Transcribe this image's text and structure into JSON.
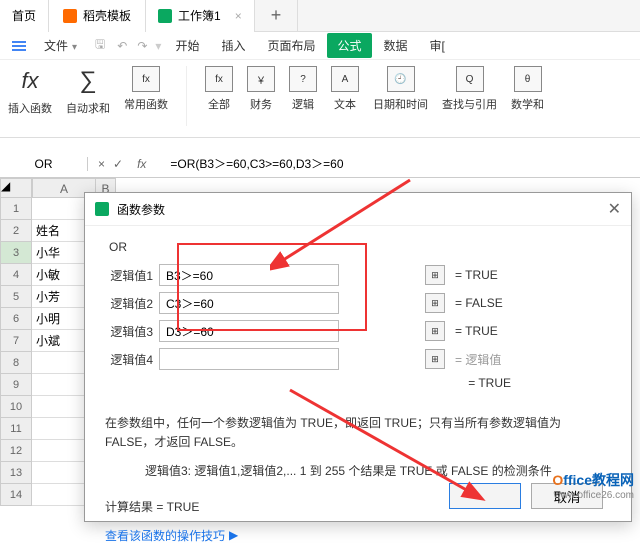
{
  "tabs": {
    "home": "首页",
    "docker": "稻壳模板",
    "sheet": "工作簿1",
    "plus": "+"
  },
  "menu": {
    "file": "文件",
    "start": "开始",
    "insert": "插入",
    "layout": "页面布局",
    "formula": "公式",
    "data": "数据",
    "review": "审[",
    "items_small": [
      "↩",
      "↪",
      "▾"
    ]
  },
  "ribbon": {
    "insert_fn": "插入函数",
    "autosum": "自动求和",
    "common": "常用函数",
    "all": "全部",
    "finance": "财务",
    "logic": "逻辑",
    "text": "文本",
    "datetime": "日期和时间",
    "lookup": "查找与引用",
    "math": "数学和",
    "fx": "fx",
    "sigma": "∑",
    "box_fx": "fx",
    "box_y": "￥",
    "box_q": "?",
    "box_a": "A",
    "box_clk": "🕘",
    "box_q2": "Q",
    "box_th": "θ"
  },
  "formula_bar": {
    "name": "OR",
    "cancel": "×",
    "confirm": "✓",
    "fx": "fx",
    "value": "=OR(B3＞=60,C3>=60,D3＞=60"
  },
  "columns": [
    "A",
    "B"
  ],
  "rows": [
    {
      "n": "1",
      "a": ""
    },
    {
      "n": "2",
      "a": "姓名"
    },
    {
      "n": "3",
      "a": "小华"
    },
    {
      "n": "4",
      "a": "小敏"
    },
    {
      "n": "5",
      "a": "小芳"
    },
    {
      "n": "6",
      "a": "小明"
    },
    {
      "n": "7",
      "a": "小斌"
    },
    {
      "n": "8",
      "a": ""
    },
    {
      "n": "9",
      "a": ""
    },
    {
      "n": "10",
      "a": ""
    },
    {
      "n": "11",
      "a": ""
    },
    {
      "n": "12",
      "a": ""
    },
    {
      "n": "13",
      "a": ""
    },
    {
      "n": "14",
      "a": ""
    }
  ],
  "dialog": {
    "title": "函数参数",
    "fn": "OR",
    "params": [
      {
        "label": "逻辑值1",
        "value": "B3＞=60",
        "result": "= TRUE"
      },
      {
        "label": "逻辑值2",
        "value": "C3＞=60",
        "result": "= FALSE"
      },
      {
        "label": "逻辑值3",
        "value": "D3＞=60",
        "result": "= TRUE"
      },
      {
        "label": "逻辑值4",
        "value": "",
        "result": "= 逻辑值",
        "ph": true
      }
    ],
    "overall": "= TRUE",
    "desc": "在参数组中，任何一个参数逻辑值为 TRUE，即返回 TRUE；只有当所有参数逻辑值为 FALSE，才返回 FALSE。",
    "desc2": "逻辑值3: 逻辑值1,逻辑值2,... 1 到 255 个结果是 TRUE 或 FALSE 的检测条件",
    "calc": "计算结果 = TRUE",
    "link": "查看该函数的操作技巧",
    "ok": "",
    "cancel": "取消"
  },
  "watermark": {
    "text1": "O",
    "text2": "ffice教程网",
    "url": "www.office26.com"
  }
}
